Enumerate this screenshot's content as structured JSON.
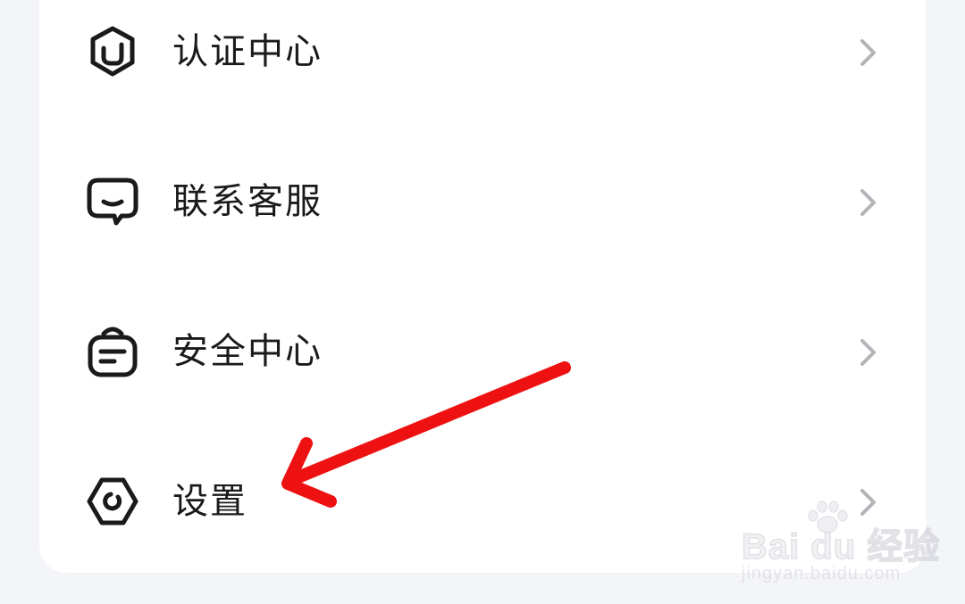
{
  "menu": {
    "items": [
      {
        "label": "认证中心",
        "icon": "certification-icon"
      },
      {
        "label": "联系客服",
        "icon": "customer-service-icon"
      },
      {
        "label": "安全中心",
        "icon": "security-icon"
      },
      {
        "label": "设置",
        "icon": "settings-icon"
      }
    ]
  },
  "annotation": {
    "color": "#ee1111"
  },
  "watermark": {
    "brand": "Bai du 经验",
    "url": "jingyan.baidu.com"
  }
}
